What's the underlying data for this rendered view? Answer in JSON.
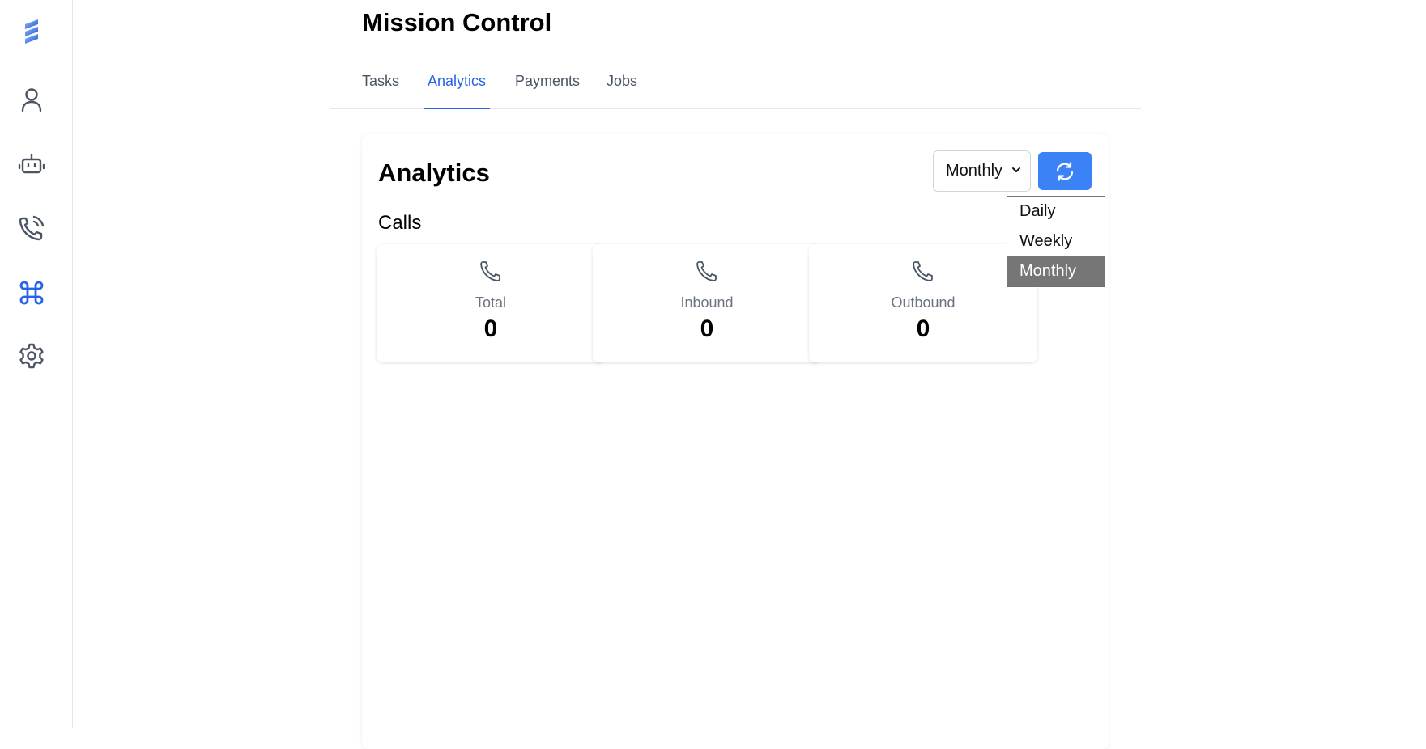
{
  "sidebar": {
    "items": [
      {
        "icon": "logo-icon"
      },
      {
        "icon": "user-icon"
      },
      {
        "icon": "bot-icon"
      },
      {
        "icon": "phone-call-icon"
      },
      {
        "icon": "command-icon",
        "active": true
      },
      {
        "icon": "settings-icon"
      }
    ]
  },
  "header": {
    "title": "Mission Control"
  },
  "tabs": [
    {
      "label": "Tasks"
    },
    {
      "label": "Analytics",
      "active": true
    },
    {
      "label": "Payments"
    },
    {
      "label": "Jobs"
    }
  ],
  "card": {
    "title": "Analytics",
    "period_select": {
      "value": "Monthly",
      "options": [
        "Daily",
        "Weekly",
        "Monthly"
      ]
    },
    "section_title": "Calls",
    "stats": [
      {
        "label": "Total",
        "value": "0"
      },
      {
        "label": "Inbound",
        "value": "0"
      },
      {
        "label": "Outbound",
        "value": "0"
      }
    ]
  },
  "colors": {
    "accent": "#2563eb",
    "button": "#3b82f6",
    "selected_option": "#767676"
  }
}
